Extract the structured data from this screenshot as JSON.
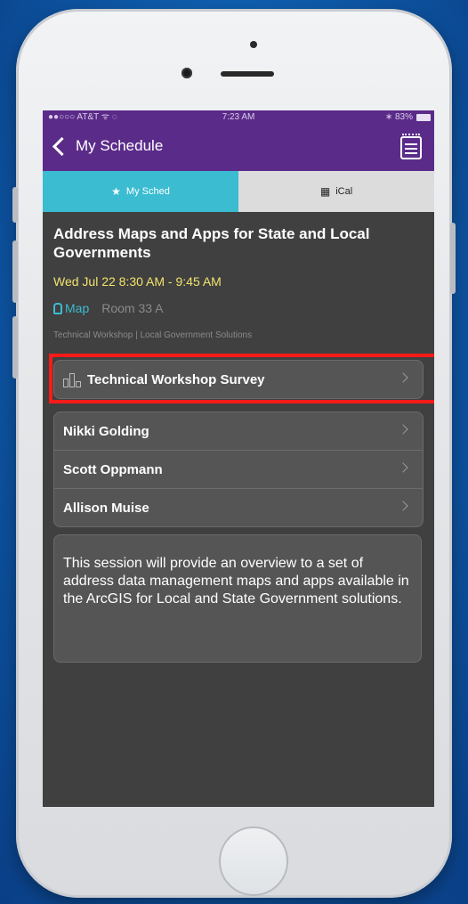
{
  "status_bar": {
    "carrier": "●●○○○ AT&T ᯤ ◌",
    "time": "7:23 AM",
    "battery": "∗ 83%"
  },
  "nav": {
    "back_label": "My Schedule"
  },
  "segments": [
    {
      "label": "My Sched",
      "glyph": "★",
      "active": true
    },
    {
      "label": "iCal",
      "glyph": "▦",
      "active": false
    }
  ],
  "session": {
    "title": "Address Maps and Apps for State and Local Governments",
    "time": "Wed Jul 22 8:30 AM - 9:45 AM",
    "map_link": "Map",
    "room": "Room 33 A",
    "track": "Technical Workshop | Local Government Solutions",
    "survey_label": "Technical Workshop Survey",
    "speakers": [
      "Nikki Golding",
      "Scott Oppmann",
      "Allison Muise"
    ],
    "description": "This session will provide an overview to a set of address data management maps and apps available in the ArcGIS for Local and State Government solutions."
  },
  "colors": {
    "nav": "#5b2b8a",
    "accent": "#3bbcd0",
    "time": "#f2e36b",
    "highlight": "#ff1a1a"
  }
}
